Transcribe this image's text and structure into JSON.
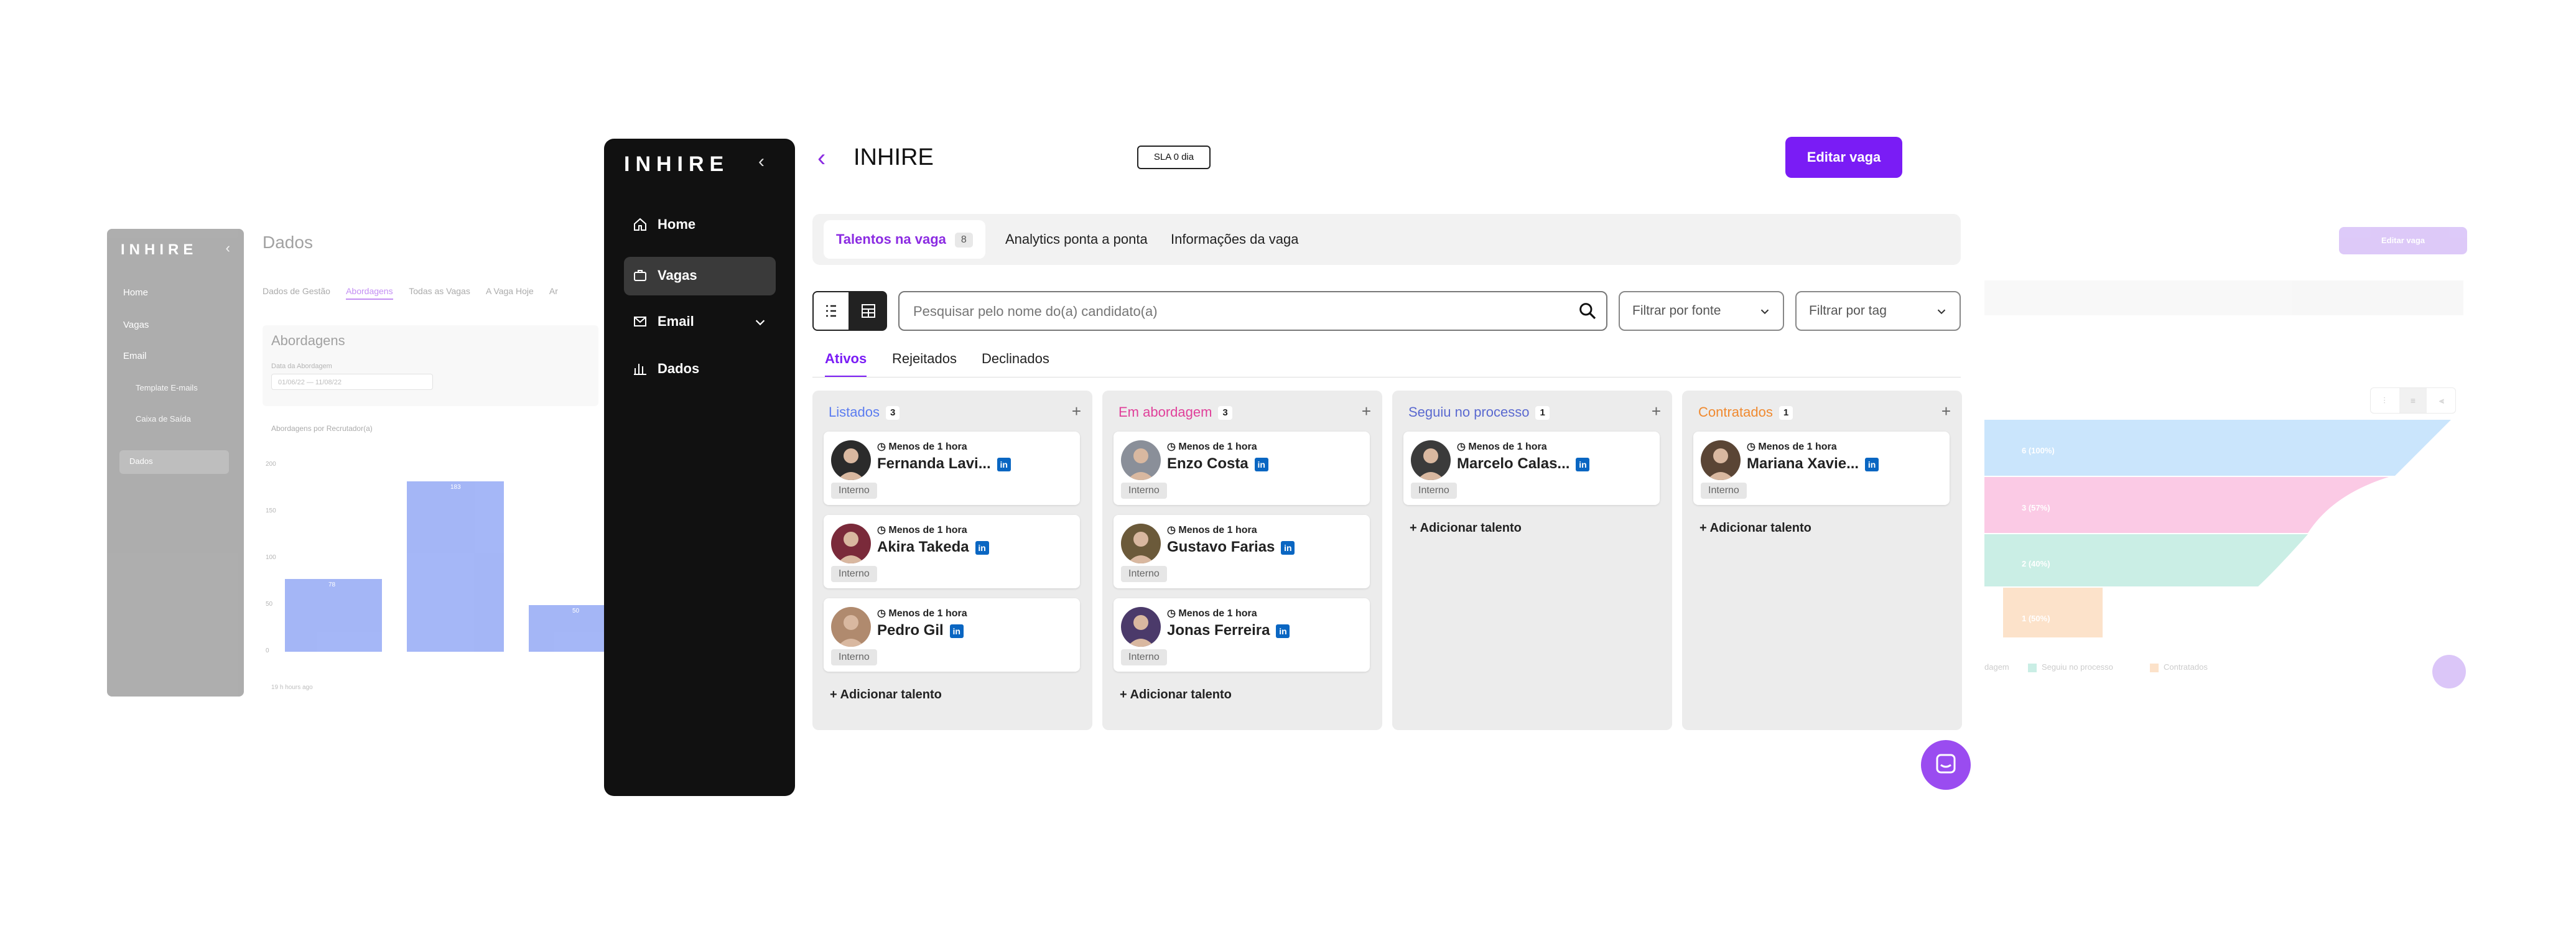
{
  "bg_left": {
    "logo": "INHIRE",
    "nav": [
      "Home",
      "Vagas",
      "Email",
      "Template E-mails",
      "Caixa de Saída",
      "Dados"
    ],
    "title": "Dados",
    "tabs": [
      "Dados de Gestão",
      "Abordagens",
      "Todas as Vagas",
      "A Vaga Hoje",
      "Ar"
    ],
    "card_title": "Abordagens",
    "date_label": "Data da Abordagem",
    "date_value": "01/06/22  —  11/08/22",
    "chart_title": "Abordagens por Recrutador(a)",
    "chart_foot": "19 h hours ago",
    "chart_data": {
      "type": "bar",
      "categories": [
        "",
        "",
        ""
      ],
      "values": [
        78,
        183,
        50
      ],
      "value_labels": [
        "78",
        "183",
        "50"
      ],
      "ylim": [
        0,
        200
      ],
      "yticks": [
        "200",
        "150",
        "100",
        "50",
        "0"
      ]
    }
  },
  "bg_right": {
    "edit_label": "Editar vaga",
    "funnel_labels": [
      "6 (100%)",
      "3 (57%)",
      "2 (40%)",
      "1 (50%)"
    ],
    "legend": [
      "dagem",
      "Seguiu no processo",
      "Contratados"
    ]
  },
  "sidebar": {
    "logo": "INHIRE",
    "items": [
      {
        "label": "Home"
      },
      {
        "label": "Vagas"
      },
      {
        "label": "Email"
      },
      {
        "label": "Dados"
      }
    ]
  },
  "header": {
    "title": "INHIRE",
    "sla": "SLA 0 dia",
    "edit_label": "Editar vaga"
  },
  "tabs": {
    "talentos": "Talentos na vaga",
    "talentos_count": "8",
    "analytics": "Analytics ponta a ponta",
    "info": "Informações da vaga"
  },
  "search": {
    "placeholder": "Pesquisar pelo nome do(a) candidato(a)"
  },
  "filters": {
    "fonte": "Filtrar por fonte",
    "tag": "Filtrar por tag"
  },
  "subtabs": {
    "ativos": "Ativos",
    "rejeitados": "Rejeitados",
    "declinados": "Declinados"
  },
  "columns": [
    {
      "title": "Listados",
      "count": "3",
      "color": "#5b7cf0",
      "cards": [
        {
          "time": "Menos de 1 hora",
          "name": "Fernanda Lavi...",
          "tag": "Interno",
          "av": "#2b2b2b"
        },
        {
          "time": "Menos de 1 hora",
          "name": "Akira Takeda",
          "tag": "Interno",
          "av": "#7a2a3a"
        },
        {
          "time": "Menos de 1 hora",
          "name": "Pedro Gil",
          "tag": "Interno",
          "av": "#b08a6e"
        }
      ],
      "add": "Adicionar talento"
    },
    {
      "title": "Em abordagem",
      "count": "3",
      "color": "#e0409a",
      "cards": [
        {
          "time": "Menos de 1 hora",
          "name": "Enzo Costa",
          "tag": "Interno",
          "av": "#8a8f99"
        },
        {
          "time": "Menos de 1 hora",
          "name": "Gustavo Farias",
          "tag": "Interno",
          "av": "#6b5a3a"
        },
        {
          "time": "Menos de 1 hora",
          "name": "Jonas Ferreira",
          "tag": "Interno",
          "av": "#4b3a6a"
        }
      ],
      "add": "Adicionar talento"
    },
    {
      "title": "Seguiu no processo",
      "count": "1",
      "color": "#5b6ad0",
      "cards": [
        {
          "time": "Menos de 1 hora",
          "name": "Marcelo Calas...",
          "tag": "Interno",
          "av": "#3b3b3b"
        }
      ],
      "add": "Adicionar talento"
    },
    {
      "title": "Contratados",
      "count": "1",
      "color": "#f08a30",
      "cards": [
        {
          "time": "Menos de 1 hora",
          "name": "Mariana Xavie...",
          "tag": "Interno",
          "av": "#5a4535"
        }
      ],
      "add": "Adicionar talento"
    }
  ]
}
